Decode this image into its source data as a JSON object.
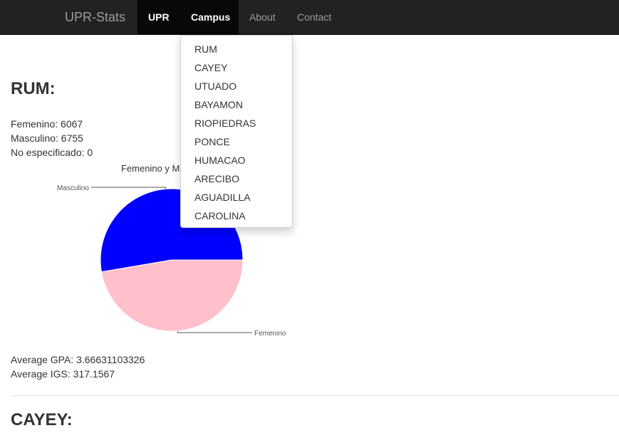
{
  "nav": {
    "brand": "UPR-Stats",
    "items": [
      {
        "label": "UPR"
      },
      {
        "label": "Campus"
      },
      {
        "label": "About"
      },
      {
        "label": "Contact"
      }
    ],
    "campus_dropdown": [
      "RUM",
      "CAYEY",
      "UTUADO",
      "BAYAMON",
      "RIOPIEDRAS",
      "PONCE",
      "HUMACAO",
      "ARECIBO",
      "AGUADILLA",
      "CAROLINA"
    ]
  },
  "sections": [
    {
      "heading": "RUM:",
      "femenino": "Femenino: 6067",
      "masculino": "Masculino: 6755",
      "no_especificado": "No especificado: 0",
      "avg_gpa": "Average GPA: 3.66631103326",
      "avg_igs": "Average IGS: 317.1567"
    },
    {
      "heading": "CAYEY:"
    }
  ],
  "chart_data": {
    "type": "pie",
    "title": "Femenino y M",
    "labels": [
      "Masculino",
      "Femenino"
    ],
    "values": [
      6755,
      6067
    ],
    "colors": [
      "#0000ff",
      "#ffc0cb"
    ]
  }
}
